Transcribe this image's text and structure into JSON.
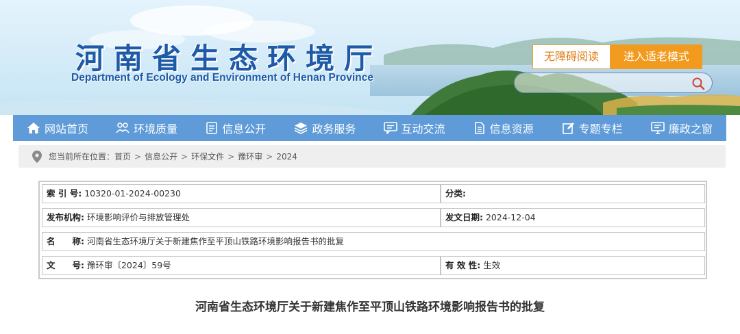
{
  "header": {
    "title": "河南省生态环境厅",
    "subtitle": "Department of Ecology and Environment of Henan Province",
    "accessibility_label": "无障碍阅读",
    "elder_mode_label": "进入适老模式",
    "search": {
      "value": "",
      "placeholder": ""
    }
  },
  "nav": {
    "items": [
      {
        "label": "网站首页",
        "icon": "home-icon"
      },
      {
        "label": "环境质量",
        "icon": "people-icon"
      },
      {
        "label": "信息公开",
        "icon": "document-icon"
      },
      {
        "label": "政务服务",
        "icon": "layers-icon"
      },
      {
        "label": "互动交流",
        "icon": "chat-icon"
      },
      {
        "label": "信息资源",
        "icon": "file-icon"
      },
      {
        "label": "专题专栏",
        "icon": "edit-icon"
      },
      {
        "label": "廉政之窗",
        "icon": "monitor-icon"
      }
    ]
  },
  "breadcrumb": {
    "prefix": "您当前所在位置：",
    "items": [
      "首页",
      "信息公开",
      "环保文件",
      "豫环审",
      "2024"
    ],
    "separator": ">"
  },
  "info": {
    "index_label": "索 引 号:",
    "index_value": "10320-01-2024-00230",
    "category_label": "分类:",
    "category_value": "",
    "publisher_label": "发布机构:",
    "publisher_value": "环境影响评价与排放管理处",
    "date_label": "发文日期:",
    "date_value": "2024-12-04",
    "name_label": "名　　称:",
    "name_value": "河南省生态环境厅关于新建焦作至平顶山铁路环境影响报告书的批复",
    "docno_label": "文　　号:",
    "docno_value": "豫环审〔2024〕59号",
    "validity_label": "有 效 性:",
    "validity_value": "生效"
  },
  "document": {
    "title": "河南省生态环境厅关于新建焦作至平顶山铁路环境影响报告书的批复"
  },
  "colors": {
    "brand_blue": "#1d5aa8",
    "nav_blue": "#5e9bd8",
    "accent_orange": "#f29a1e"
  }
}
